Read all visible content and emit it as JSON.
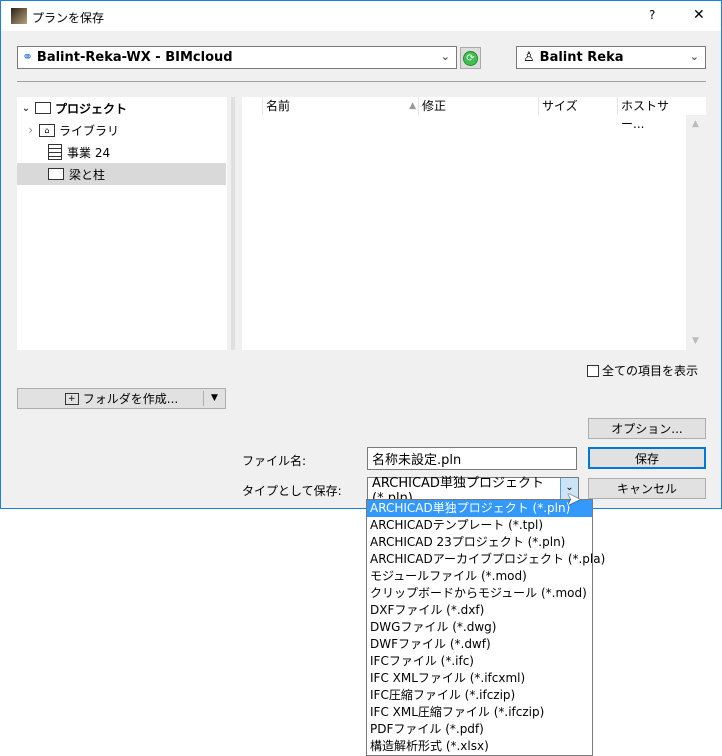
{
  "window": {
    "title": "プランを保存",
    "help": "?",
    "close": "✕"
  },
  "server": {
    "value": "Balint-Reka-WX - BIMcloud",
    "user": "Balint Reka"
  },
  "tree": {
    "items": [
      {
        "label": "プロジェクト",
        "icon": "folder-icon",
        "expander": "⌄"
      },
      {
        "label": "ライブラリ",
        "icon": "library-folder-icon",
        "expander": "›"
      },
      {
        "label": "事業 24",
        "icon": "building-icon"
      },
      {
        "label": "梁と柱",
        "icon": "folder-icon",
        "selected": true
      }
    ]
  },
  "list": {
    "columns": [
      "名前",
      "修正",
      "サイズ",
      "ホストサー..."
    ]
  },
  "show_all_label": "全ての項目を表示",
  "new_folder_label": "フォルダを作成...",
  "options_label": "オプション...",
  "filename_label": "ファイル名:",
  "filename_value": "名称未設定.pln",
  "save_label": "保存",
  "type_label": "タイプとして保存:",
  "type_value": "ARCHICAD単独プロジェクト (*.pln)",
  "cancel_label": "キャンセル",
  "type_options": [
    "ARCHICAD単独プロジェクト (*.pln)",
    "ARCHICADテンプレート (*.tpl)",
    "ARCHICAD 23プロジェクト (*.pln)",
    "ARCHICADアーカイブプロジェクト (*.pla)",
    "モジュールファイル (*.mod)",
    "クリップボードからモジュール (*.mod)",
    "DXFファイル (*.dxf)",
    "DWGファイル (*.dwg)",
    "DWFファイル (*.dwf)",
    "IFCファイル (*.ifc)",
    "IFC XMLファイル (*.ifcxml)",
    "IFC圧縮ファイル (*.ifczip)",
    "IFC XML圧縮ファイル (*.ifczip)",
    "PDFファイル (*.pdf)",
    "構造解析形式 (*.xlsx)"
  ]
}
